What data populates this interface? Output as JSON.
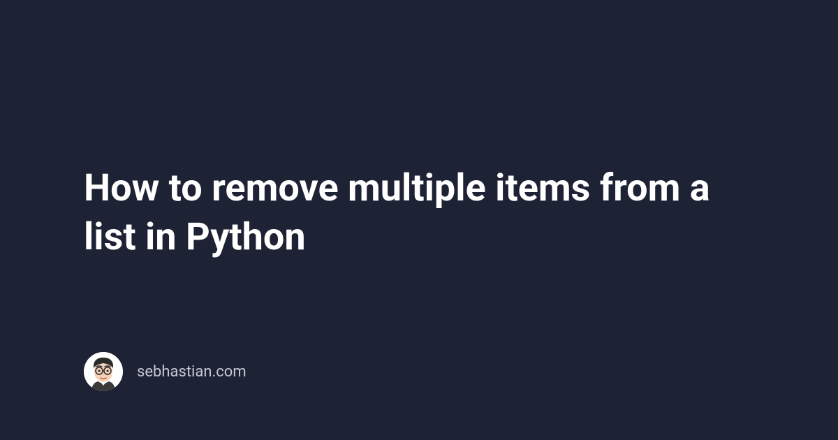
{
  "title": "How to remove multiple items from a list in Python",
  "author": {
    "site_name": "sebhastian.com"
  }
}
